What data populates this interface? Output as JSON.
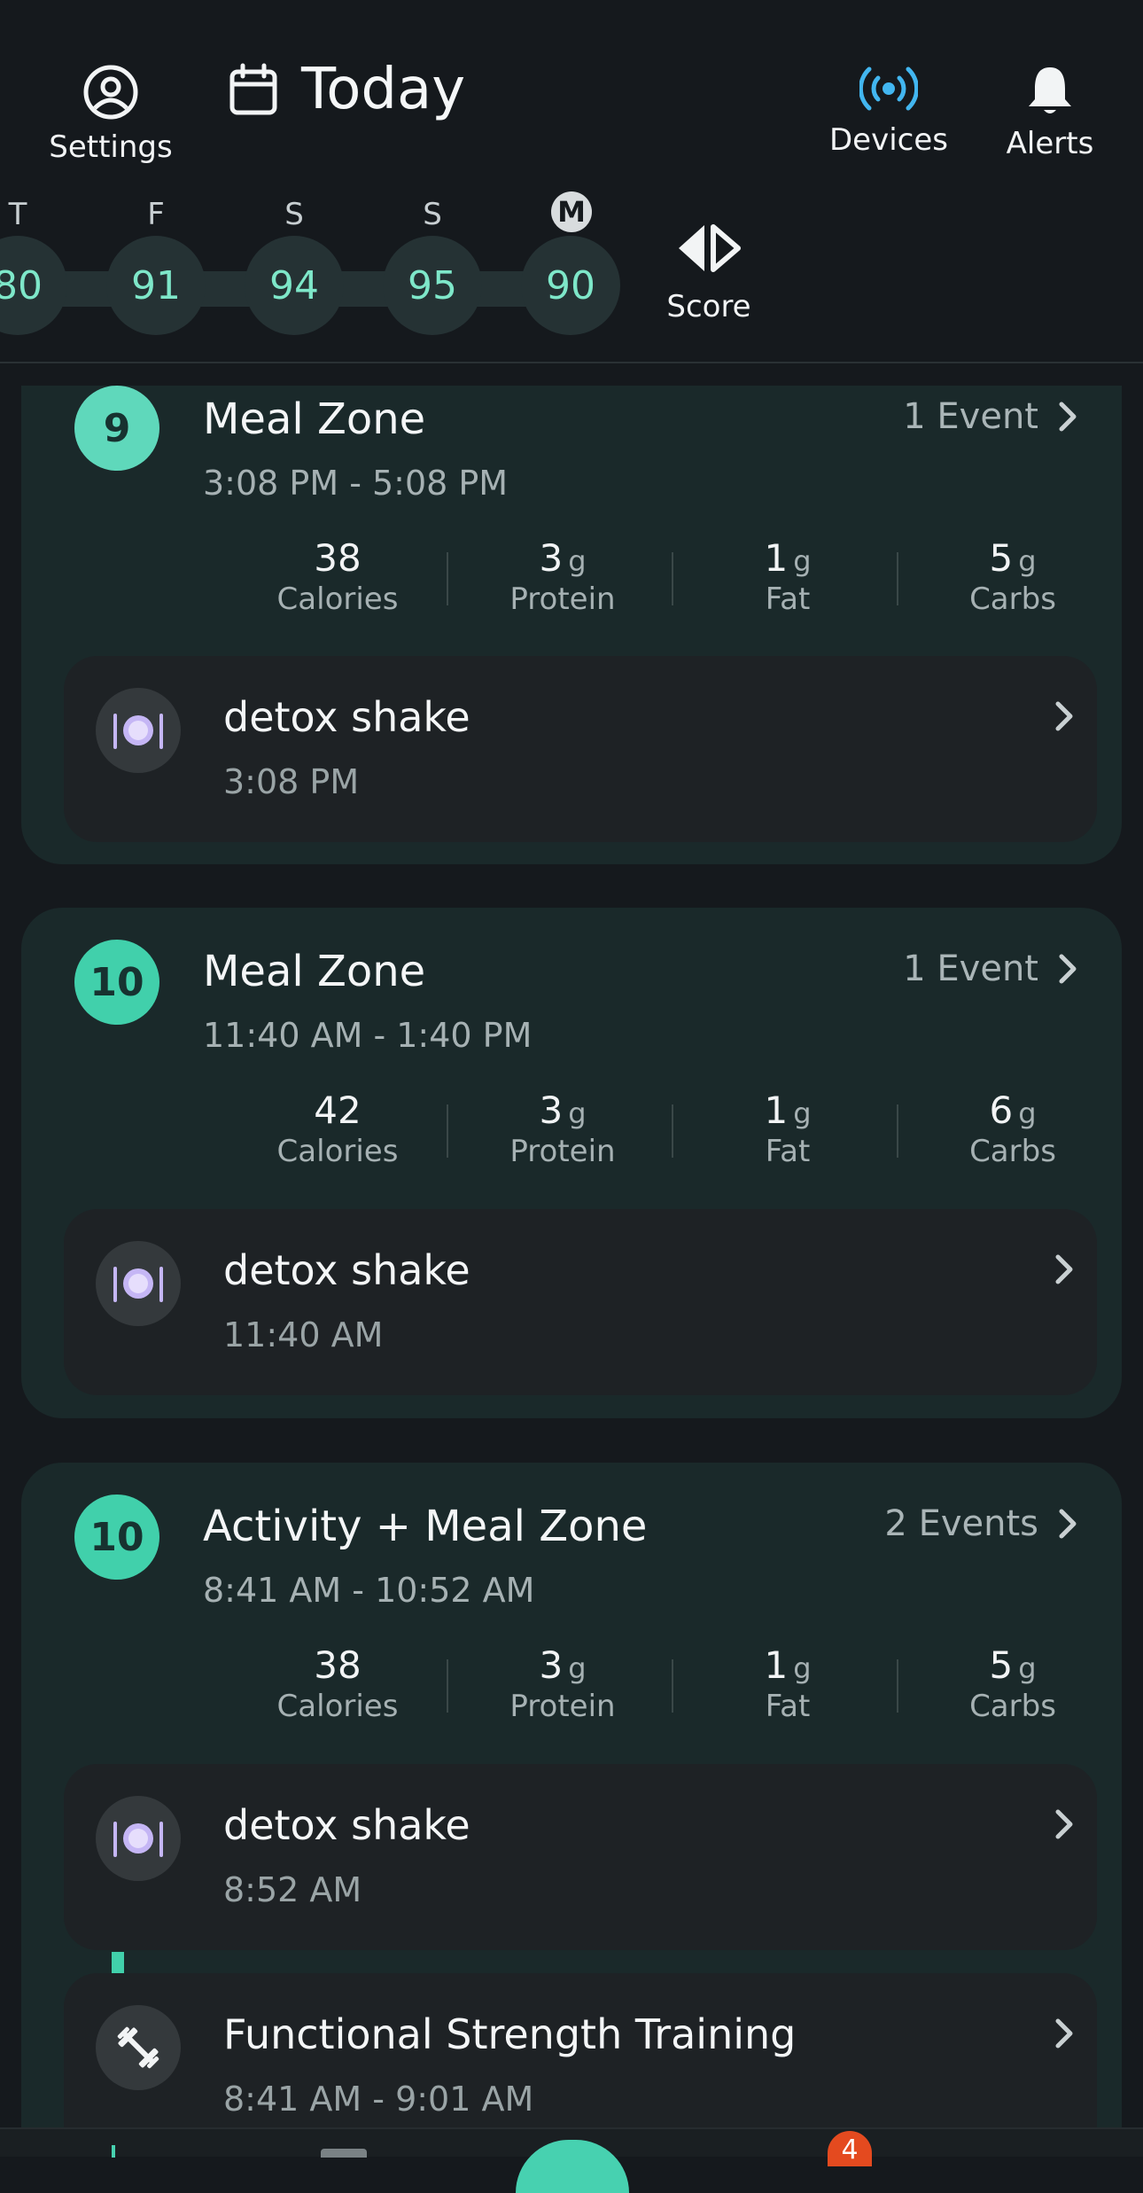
{
  "header": {
    "title": "Today",
    "settings_label": "Settings",
    "devices_label": "Devices",
    "alerts_label": "Alerts",
    "score_label": "Score",
    "accent_color": "#42b6f0",
    "icons": [
      "user-circle-icon",
      "calendar-icon",
      "broadcast-icon",
      "bell-icon",
      "chevrons-left-right-icon"
    ]
  },
  "days": [
    {
      "letter": "T",
      "score": "80"
    },
    {
      "letter": "F",
      "score": "91"
    },
    {
      "letter": "S",
      "score": "94"
    },
    {
      "letter": "S",
      "score": "95"
    },
    {
      "letter": "M",
      "score": "90",
      "today": true
    }
  ],
  "zones": [
    {
      "badge": "9",
      "title": "Meal Zone",
      "time": "3:08 PM - 5:08 PM",
      "events": "1 Event",
      "macros": [
        {
          "value": "38",
          "unit": "",
          "label": "Calories"
        },
        {
          "value": "3",
          "unit": "g",
          "label": "Protein"
        },
        {
          "value": "1",
          "unit": "g",
          "label": "Fat"
        },
        {
          "value": "5",
          "unit": "g",
          "label": "Carbs"
        }
      ],
      "items": [
        {
          "title": "detox shake",
          "time": "3:08 PM",
          "icon": "plate-utensils-icon"
        }
      ]
    },
    {
      "badge": "10",
      "title": "Meal Zone",
      "time": "11:40 AM - 1:40 PM",
      "events": "1 Event",
      "macros": [
        {
          "value": "42",
          "unit": "",
          "label": "Calories"
        },
        {
          "value": "3",
          "unit": "g",
          "label": "Protein"
        },
        {
          "value": "1",
          "unit": "g",
          "label": "Fat"
        },
        {
          "value": "6",
          "unit": "g",
          "label": "Carbs"
        }
      ],
      "items": [
        {
          "title": "detox shake",
          "time": "11:40 AM",
          "icon": "plate-utensils-icon"
        }
      ]
    },
    {
      "badge": "10",
      "title": "Activity + Meal Zone",
      "time": "8:41 AM - 10:52 AM",
      "events": "2 Events",
      "macros": [
        {
          "value": "38",
          "unit": "",
          "label": "Calories"
        },
        {
          "value": "3",
          "unit": "g",
          "label": "Protein"
        },
        {
          "value": "1",
          "unit": "g",
          "label": "Fat"
        },
        {
          "value": "5",
          "unit": "g",
          "label": "Carbs"
        }
      ],
      "items": [
        {
          "title": "detox shake",
          "time": "8:52 AM",
          "icon": "plate-utensils-icon"
        },
        {
          "title": "Functional Strength Training",
          "time": "8:41 AM - 9:01 AM",
          "icon": "dumbbell-icon"
        }
      ]
    }
  ],
  "tab_bar": {
    "notification_count": "4"
  }
}
